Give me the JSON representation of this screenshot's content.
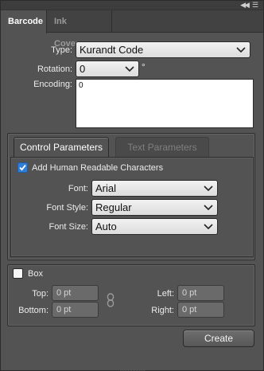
{
  "header": {
    "collapse_icon": "collapse-arrows-icon",
    "menu_icon": "panel-menu-icon"
  },
  "tabs": [
    {
      "label": "Barcode",
      "active": true
    },
    {
      "label": "Ink Coverage",
      "active": false
    }
  ],
  "barcode": {
    "type_label": "Type:",
    "type_value": "Kurandt Code",
    "rotation_label": "Rotation:",
    "rotation_value": "0",
    "rotation_unit": "°",
    "encoding_label": "Encoding:",
    "encoding_value": "0"
  },
  "parameter_tabs": [
    {
      "label": "Control Parameters",
      "active": true
    },
    {
      "label": "Text Parameters",
      "active": false
    }
  ],
  "text_options": {
    "human_readable_label": "Add Human Readable Characters",
    "human_readable_checked": true,
    "font_label": "Font:",
    "font_value": "Arial",
    "font_style_label": "Font Style:",
    "font_style_value": "Regular",
    "font_size_label": "Font Size:",
    "font_size_value": "Auto"
  },
  "box": {
    "label": "Box",
    "checked": false,
    "top_label": "Top:",
    "top_value": "0 pt",
    "bottom_label": "Bottom:",
    "bottom_value": "0 pt",
    "left_label": "Left:",
    "left_value": "0 pt",
    "right_label": "Right:",
    "right_value": "0 pt",
    "link_icon": "chain-link-icon"
  },
  "actions": {
    "create_label": "Create"
  },
  "colors": {
    "panel_bg": "#535353",
    "checkbox_accent": "#2f7ed8"
  }
}
